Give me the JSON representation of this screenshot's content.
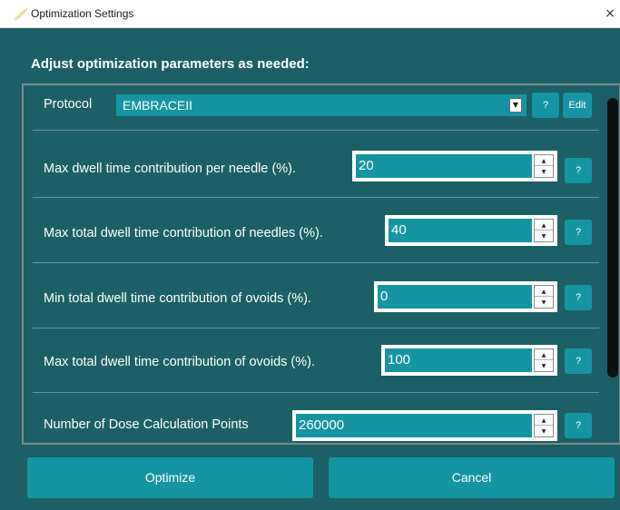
{
  "window": {
    "title": "Optimization Settings",
    "close_glyph": "×"
  },
  "heading": "Adjust optimization parameters as needed:",
  "protocol": {
    "label": "Protocol",
    "value": "EMBRACEII",
    "arrow_glyph": "▼",
    "help_label": "?",
    "edit_label": "Edit"
  },
  "params": [
    {
      "label": "Max dwell time contribution per needle (%).",
      "value": "20",
      "help_label": "?"
    },
    {
      "label": "Max total dwell time contribution of needles (%).",
      "value": "40",
      "help_label": "?"
    },
    {
      "label": "Min total dwell time contribution of ovoids (%).",
      "value": "0",
      "help_label": "?"
    },
    {
      "label": "Max total dwell time contribution of ovoids (%).",
      "value": "100",
      "help_label": "?"
    },
    {
      "label": "Number of Dose Calculation Points",
      "value": "260000",
      "help_label": "?"
    }
  ],
  "spin": {
    "up_glyph": "▲",
    "down_glyph": "▼"
  },
  "buttons": {
    "optimize": "Optimize",
    "cancel": "Cancel"
  },
  "colors": {
    "window_bg": "#1c5f66",
    "accent": "#1595a1",
    "text": "#ffffff"
  },
  "icons": {
    "app": "feather-icon",
    "close": "close-icon"
  }
}
